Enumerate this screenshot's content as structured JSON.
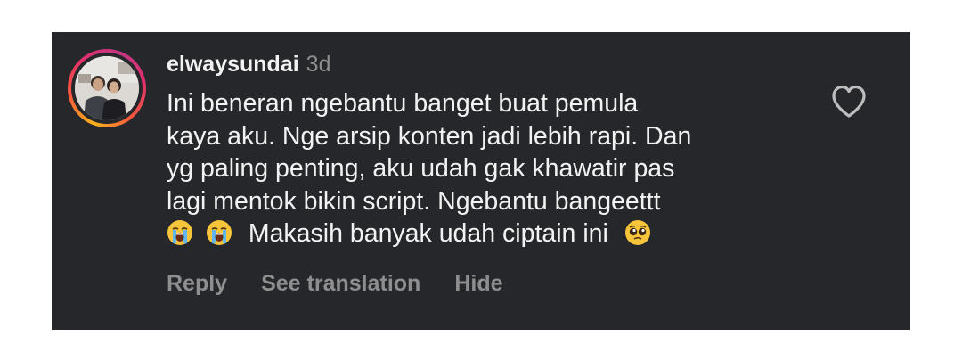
{
  "comment": {
    "username": "elwaysundai",
    "time_ago": "3d",
    "text_lines": [
      "Ini beneran ngebantu banget buat pemula",
      "kaya aku. Nge arsip konten jadi lebih rapi. Dan",
      "yg paling penting, aku udah gak khawatir pas",
      "lagi mentok bikin script. Ngebantu bangeettt"
    ],
    "last_line_text": "Makasih banyak udah ciptain ini",
    "emojis": [
      "loudly-crying-face",
      "loudly-crying-face",
      "pleading-face"
    ],
    "avatar_icon": "profile-photo",
    "like_icon": "heart-outline-icon"
  },
  "actions": {
    "reply": "Reply",
    "see_translation": "See translation",
    "hide": "Hide"
  },
  "colors": {
    "background": "#26272b",
    "text": "#f2f2f2",
    "muted": "#8e8e8e"
  }
}
